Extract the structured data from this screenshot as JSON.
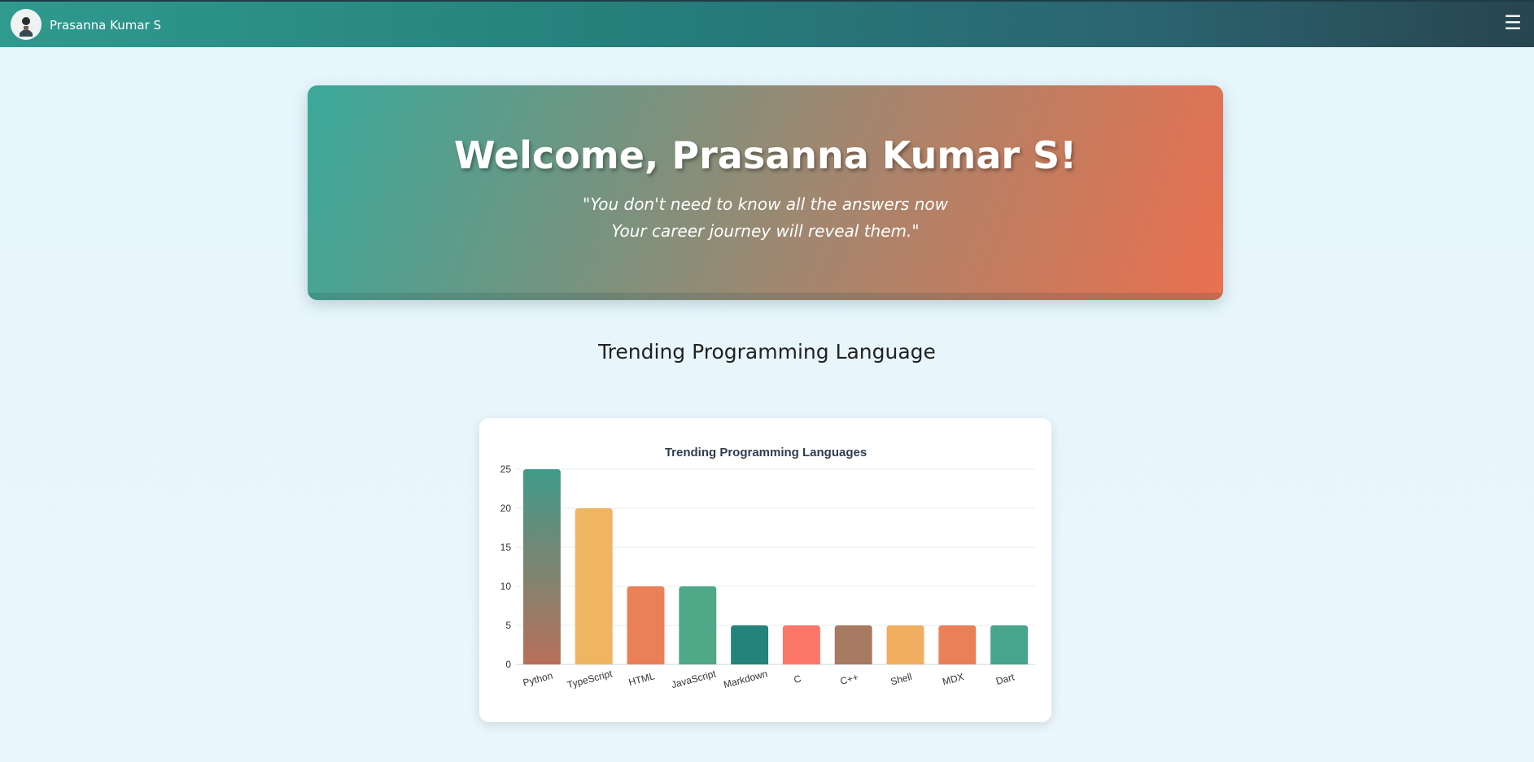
{
  "navbar": {
    "user_name": "Prasanna Kumar S",
    "avatar_icon": "user-avatar-icon",
    "menu_icon": "☰"
  },
  "hero": {
    "title": "Welcome, Prasanna Kumar S!",
    "quote_line1": "\"You don't need to know all the answers now",
    "quote_line2": "Your career journey will reveal them.\""
  },
  "section": {
    "title": "Trending Programming Language"
  },
  "chart_data": {
    "type": "bar",
    "title": "Trending Programming Languages",
    "categories": [
      "Python",
      "TypeScript",
      "HTML",
      "JavaScript",
      "Markdown",
      "C",
      "C++",
      "Shell",
      "MDX",
      "Dart"
    ],
    "values": [
      25,
      20,
      10,
      10,
      5,
      5,
      5,
      5,
      5,
      5
    ],
    "colors": [
      "python-gradient",
      "#f0b560",
      "#ea8058",
      "#4fa888",
      "#24837b",
      "#fd7769",
      "#a77a62",
      "#f1ad60",
      "#ea8058",
      "#46a58a"
    ],
    "gradient_python": [
      "#3f9b8a",
      "#b8705a"
    ],
    "ylim": [
      0,
      25
    ],
    "yticks": [
      0,
      5,
      10,
      15,
      20,
      25
    ],
    "grid": true,
    "legend": "none",
    "xlabel": "",
    "ylabel": ""
  }
}
